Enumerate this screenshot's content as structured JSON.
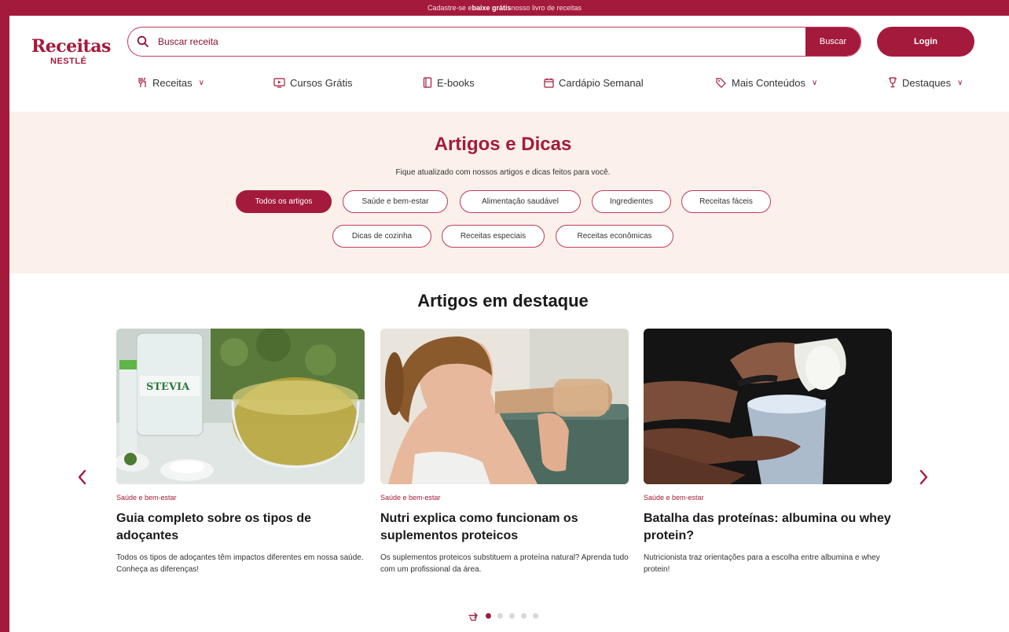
{
  "promo": {
    "text_before": "Cadastre-se e ",
    "bold": "baixe grátis",
    "text_after": " nosso livro de receitas"
  },
  "brand": {
    "line1": "Receitas",
    "line2": "NESTLÉ"
  },
  "search": {
    "placeholder": "Buscar receita",
    "button": "Buscar"
  },
  "login": "Login",
  "nav": [
    {
      "label": "Receitas",
      "icon": "cutlery-icon",
      "dropdown": true
    },
    {
      "label": "Cursos Grátis",
      "icon": "video-screen-icon",
      "dropdown": false
    },
    {
      "label": "E-books",
      "icon": "book-icon",
      "dropdown": false
    },
    {
      "label": "Cardápio Semanal",
      "icon": "calendar-icon",
      "dropdown": false
    },
    {
      "label": "Mais Conteúdos",
      "icon": "tag-icon",
      "dropdown": true
    },
    {
      "label": "Destaques",
      "icon": "trophy-icon",
      "dropdown": true
    }
  ],
  "hero": {
    "title": "Artigos e Dicas",
    "subtitle": "Fique atualizado com nossos artigos e dicas feitos para você.",
    "chips_row1": [
      "Todos os artigos",
      "Saúde e bem-estar",
      "Alimentação saudável",
      "Ingredientes",
      "Receitas fáceis"
    ],
    "chips_row2": [
      "Dicas de cozinha",
      "Receitas especiais",
      "Receitas econômicas"
    ]
  },
  "featured": {
    "title": "Artigos em destaque",
    "cards": [
      {
        "tag": "Saúde e bem-estar",
        "title": "Guia completo sobre os tipos de adoçantes",
        "desc": "Todos os tipos de adoçantes têm impactos diferentes em nossa saúde. Conheça as diferenças!",
        "image_label": "STEVIA"
      },
      {
        "tag": "Saúde e bem-estar",
        "title": "Nutri explica como funcionam os suplementos proteicos",
        "desc": "Os suplementos proteicos substituem a proteína natural? Aprenda tudo com um profissional da área."
      },
      {
        "tag": "Saúde e bem-estar",
        "title": "Batalha das proteínas: albumina ou whey protein?",
        "desc": "Nutricionista traz orientações para a escolha entre albumina e whey protein!"
      }
    ]
  },
  "colors": {
    "brand": "#a41a3c",
    "hero_bg": "#fbf1ea"
  }
}
